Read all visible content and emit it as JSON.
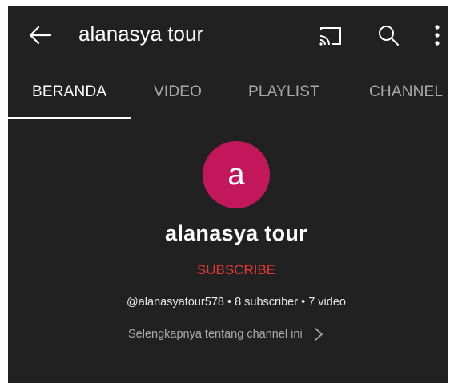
{
  "appbar": {
    "title": "alanasya tour",
    "icons": [
      "back-arrow-icon",
      "cast-icon",
      "search-icon",
      "more-vert-icon"
    ]
  },
  "tabs": [
    {
      "label": "BERANDA",
      "active": true
    },
    {
      "label": "VIDEO",
      "active": false
    },
    {
      "label": "PLAYLIST",
      "active": false
    },
    {
      "label": "CHANNEL",
      "active": false
    }
  ],
  "channel": {
    "avatar_letter": "a",
    "avatar_color": "#c2185b",
    "name": "alanasya tour",
    "subscribe_label": "SUBSCRIBE",
    "subscribe_color": "#e53935",
    "stats": "@alanasyatour578 • 8 subscriber • 7 video",
    "more_link": "Selengkapnya tentang channel ini"
  },
  "colors": {
    "background": "#212121",
    "text_primary": "#ffffff",
    "text_secondary": "#aaaaaa"
  }
}
